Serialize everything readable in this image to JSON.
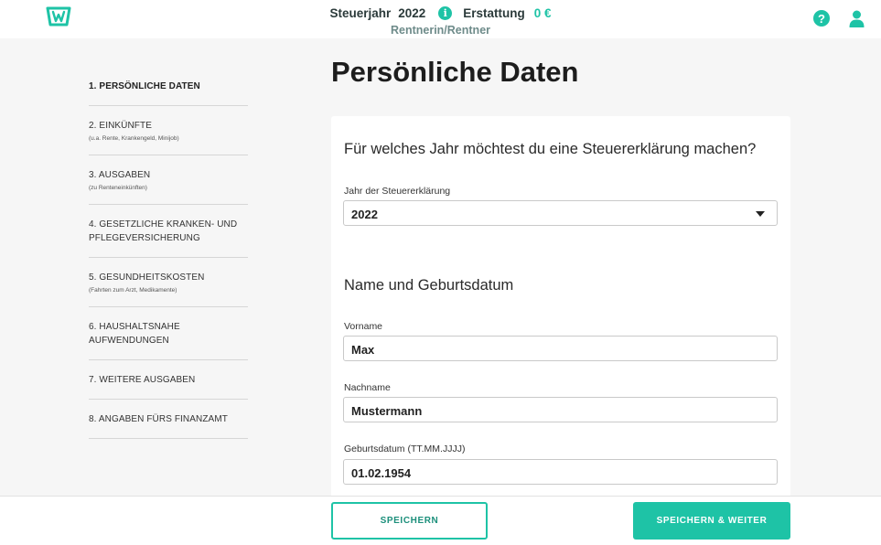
{
  "header": {
    "tax_year_label": "Steuerjahr",
    "tax_year": "2022",
    "info_icon": "info-icon",
    "refund_label": "Erstattung",
    "refund_value": "0 €",
    "profile_type": "Rentnerin/Rentner",
    "icons": {
      "logo": "app-logo",
      "help": "help-icon",
      "user": "user-icon"
    },
    "colors": {
      "accent": "#1ec3a6",
      "muted": "#6e8b8a"
    }
  },
  "sidebar": {
    "items": [
      {
        "label": "1. PERSÖNLICHE DATEN",
        "sub": "",
        "active": true
      },
      {
        "label": "2. EINKÜNFTE",
        "sub": "(u.a. Rente, Krankengeld, Minijob)"
      },
      {
        "label": "3. AUSGABEN",
        "sub": "(zu Renteneinkünften)"
      },
      {
        "label": "4. GESETZLICHE KRANKEN- UND PFLEGEVERSICHERUNG",
        "sub": ""
      },
      {
        "label": "5. GESUNDHEITSKOSTEN",
        "sub": "(Fahrten zum Arzt, Medikamente)"
      },
      {
        "label": "6. HAUSHALTSNAHE AUFWENDUNGEN",
        "sub": ""
      },
      {
        "label": "7. WEITERE AUSGABEN",
        "sub": ""
      },
      {
        "label": "8. ANGABEN FÜRS FINANZAMT",
        "sub": ""
      }
    ]
  },
  "main": {
    "title": "Persönliche Daten",
    "year_section": {
      "question": "Für welches Jahr möchtest du eine Steuererklärung machen?",
      "field_label": "Jahr der Steuererklärung",
      "selected": "2022"
    },
    "name_section": {
      "title": "Name und Geburtsdatum",
      "first_name_label": "Vorname",
      "first_name": "Max",
      "last_name_label": "Nachname",
      "last_name": "Mustermann",
      "birthdate_label": "Geburtsdatum (TT.MM.JJJJ)",
      "birthdate": "01.02.1954"
    }
  },
  "footer": {
    "save_label": "SPEICHERN",
    "save_next_label": "SPEICHERN & WEITER"
  }
}
